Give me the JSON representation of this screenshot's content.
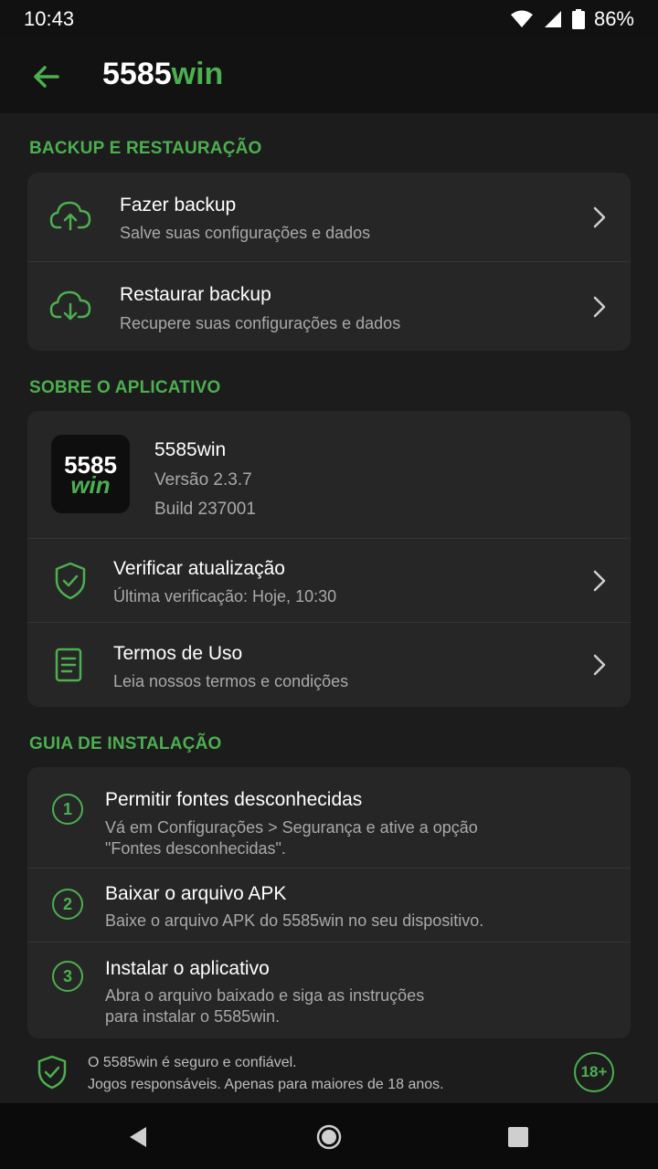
{
  "status_bar": {
    "time": "10:43",
    "battery": "86%"
  },
  "app_bar": {
    "title_part1": "5585",
    "title_part2": "win"
  },
  "sections": {
    "backup": {
      "label": "BACKUP E RESTAURAÇÃO",
      "items": [
        {
          "title": "Fazer backup",
          "subtitle": "Salve suas configurações e dados"
        },
        {
          "title": "Restaurar backup",
          "subtitle": "Recupere suas configurações e dados"
        }
      ]
    },
    "about": {
      "label": "SOBRE O APLICATIVO",
      "logo": {
        "line1": "5585",
        "line2": "win"
      },
      "app_name": "5585win",
      "version": "Versão 2.3.7",
      "build": "Build 237001",
      "items": [
        {
          "title": "Verificar atualização",
          "subtitle": "Última verificação: Hoje, 10:30"
        },
        {
          "title": "Termos de Uso",
          "subtitle": "Leia nossos termos e condições"
        }
      ]
    },
    "guide": {
      "label": "GUIA DE INSTALAÇÃO",
      "steps": [
        {
          "number": "1",
          "title": "Permitir fontes desconhecidas",
          "line1": "Vá em Configurações > Segurança e ative a opção",
          "line2": "\"Fontes desconhecidas\"."
        },
        {
          "number": "2",
          "title": "Baixar o arquivo APK",
          "line1": "Baixe o arquivo APK do 5585win no seu dispositivo."
        },
        {
          "number": "3",
          "title": "Instalar o aplicativo",
          "line1": "Abra o arquivo baixado e siga as instruções",
          "line2": "para instalar o 5585win."
        }
      ]
    }
  },
  "footer": {
    "line1": "O 5585win é seguro e confiável.",
    "line2": "Jogos responsáveis. Apenas para maiores de 18 anos.",
    "age_badge": "18+"
  },
  "colors": {
    "accent": "#4caf50",
    "background": "#1c1c1c",
    "card": "#262626"
  }
}
